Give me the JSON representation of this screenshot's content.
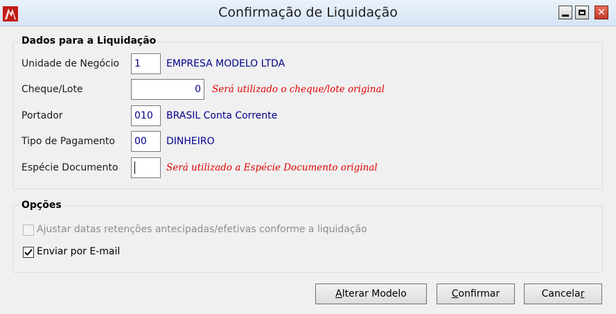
{
  "window": {
    "title": "Confirmação de Liquidação",
    "icon": "app-logo-icon",
    "controls": {
      "minimize": "minimize-icon",
      "maximize": "maximize-icon",
      "close": "close-icon"
    }
  },
  "dados": {
    "legend": "Dados para a Liquidação",
    "unidade": {
      "label": "Unidade de Negócio",
      "value": "1",
      "description": "EMPRESA MODELO LTDA"
    },
    "cheque": {
      "label": "Cheque/Lote",
      "value": "0",
      "hint": "Será utilizado o cheque/lote original"
    },
    "portador": {
      "label": "Portador",
      "value": "010",
      "description": "BRASIL Conta Corrente"
    },
    "tipo_pagamento": {
      "label": "Tipo de Pagamento",
      "value": "00",
      "description": "DINHEIRO"
    },
    "especie": {
      "label": "Espécie Documento",
      "value": "",
      "hint": "Será utilizado a Espécie Documento original"
    }
  },
  "opcoes": {
    "legend": "Opções",
    "ajustar": {
      "label": "Ajustar datas retenções antecipadas/efetivas conforme a liquidação",
      "checked": false,
      "enabled": false
    },
    "enviar_email": {
      "label": "Enviar por E-mail",
      "checked": true,
      "enabled": true
    }
  },
  "buttons": {
    "alterar": {
      "mnemonic": "A",
      "rest": "lterar Modelo"
    },
    "confirmar": {
      "mnemonic": "C",
      "rest": "onfirmar"
    },
    "cancelar": {
      "pre": "Cancela",
      "mnemonic": "r"
    }
  },
  "colors": {
    "value_text": "#00008b",
    "hint_text": "#e00000",
    "disabled_text": "#8c8c8c"
  }
}
